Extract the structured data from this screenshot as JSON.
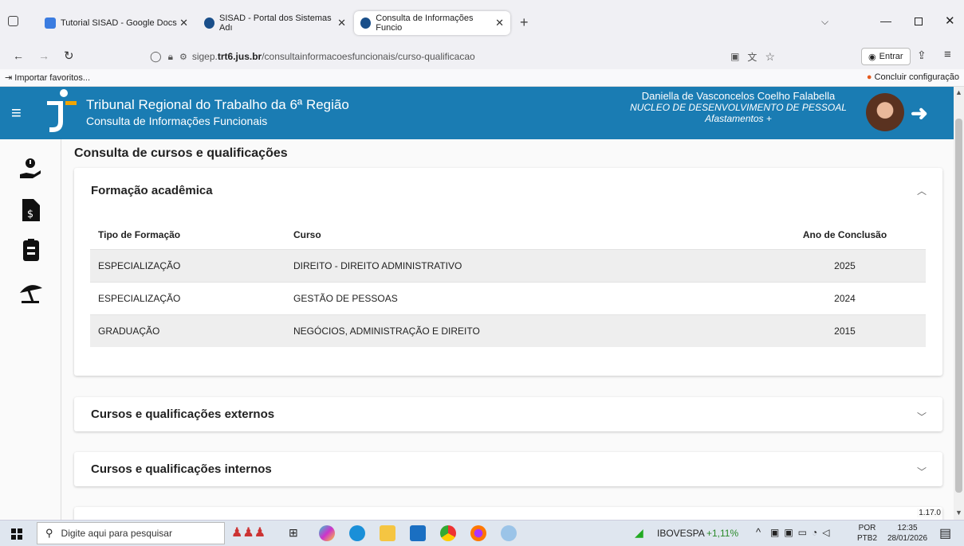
{
  "browser": {
    "tabs": [
      {
        "label": "Tutorial SISAD - Google Docs",
        "color": "#3b7ce0"
      },
      {
        "label": "SISAD - Portal dos Sistemas Adı",
        "color": "#1a4f8a"
      },
      {
        "label": "Consulta de Informações Funcio",
        "color": "#1a4f8a"
      }
    ],
    "url_prefix": "sigep.",
    "url_domain": "trt6.jus.br",
    "url_path": "/consultainformacoesfuncionais/curso-qualificacao",
    "signin_label": "Entrar",
    "bookmark_import": "Importar favoritos...",
    "bookmark_setup": "Concluir configuração"
  },
  "header": {
    "org": "Tribunal Regional do Trabalho da 6ª Região",
    "app": "Consulta de Informações Funcionais",
    "user_name": "Daniella de Vasconcelos Coelho Falabella",
    "user_unit": "NUCLEO DE DESENVOLVIMENTO DE PESSOAL",
    "user_extra": "Afastamentos +",
    "accent": "#1a7cb3"
  },
  "page": {
    "title": "Consulta de cursos e qualificações",
    "version": "1.17.0",
    "academic": {
      "title": "Formação acadêmica",
      "columns": [
        "Tipo de Formação",
        "Curso",
        "Ano de Conclusão"
      ],
      "rows": [
        [
          "ESPECIALIZAÇÃO",
          "DIREITO - DIREITO ADMINISTRATIVO",
          "2025"
        ],
        [
          "ESPECIALIZAÇÃO",
          "GESTÃO DE PESSOAS",
          "2024"
        ],
        [
          "GRADUAÇÃO",
          "NEGÓCIOS, ADMINISTRAÇÃO E DIREITO",
          "2015"
        ]
      ]
    },
    "external_title": "Cursos e qualificações externos",
    "internal_title": "Cursos e qualificações internos"
  },
  "taskbar": {
    "search_placeholder": "Digite aqui para pesquisar",
    "stock_name": "IBOVESPA",
    "stock_change": "+1,11%",
    "lang": "POR",
    "layout": "PTB2",
    "time": "12:35",
    "date": "28/01/2026"
  }
}
